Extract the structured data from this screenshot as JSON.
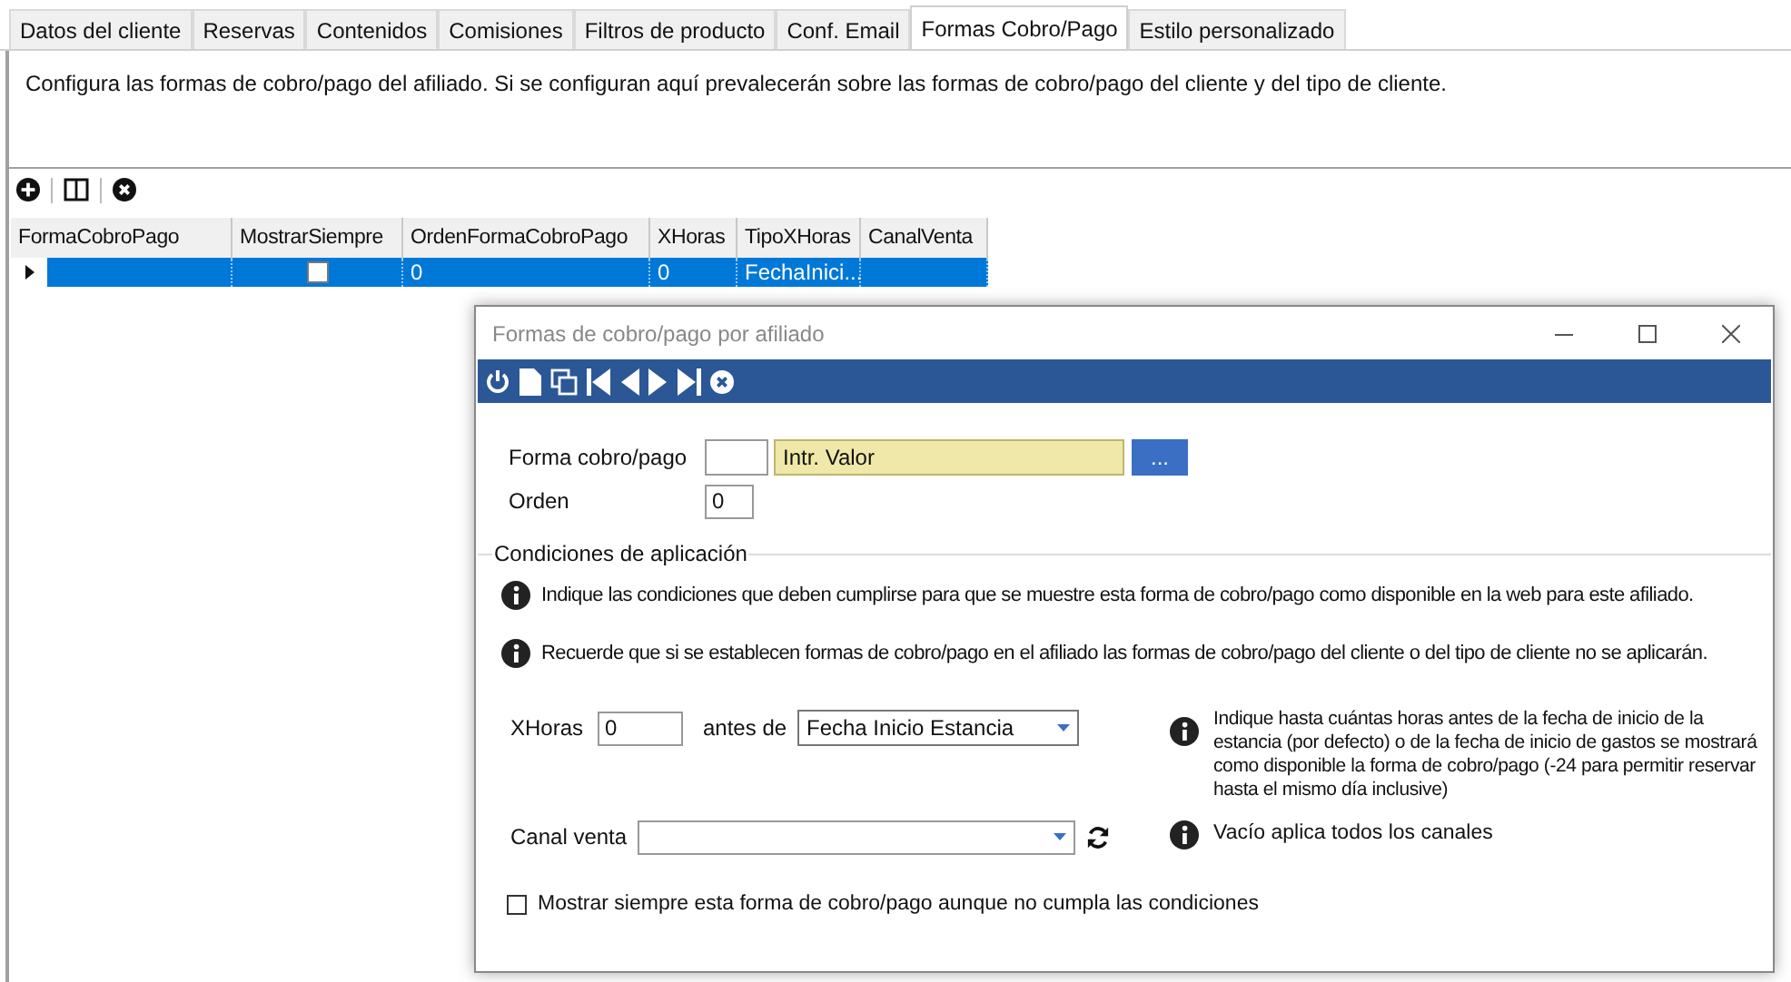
{
  "tabs": [
    {
      "label": "Datos del cliente",
      "selected": false
    },
    {
      "label": "Reservas",
      "selected": false
    },
    {
      "label": "Contenidos",
      "selected": false
    },
    {
      "label": "Comisiones",
      "selected": false
    },
    {
      "label": "Filtros de producto",
      "selected": false
    },
    {
      "label": "Conf. Email",
      "selected": false
    },
    {
      "label": "Formas Cobro/Pago",
      "selected": true
    },
    {
      "label": "Estilo personalizado",
      "selected": false
    }
  ],
  "description": "Configura las formas de cobro/pago del afiliado. Si se configuran aquí prevalecerán sobre las formas de cobro/pago del cliente y del tipo de cliente.",
  "grid": {
    "columns": [
      "FormaCobroPago",
      "MostrarSiempre",
      "OrdenFormaCobroPago",
      "XHoras",
      "TipoXHoras",
      "CanalVenta"
    ],
    "rows": [
      {
        "selected": true,
        "mostrar_siempre": false,
        "cells": [
          null,
          null,
          "0",
          "0",
          "FechaInici...",
          null
        ]
      }
    ]
  },
  "dialog": {
    "title": "Formas de cobro/pago por afiliado",
    "forma_label": "Forma cobro/pago",
    "forma_name": "Intr. Valor",
    "browse_button": "...",
    "orden_label": "Orden",
    "orden_value": "0",
    "section_title": "Condiciones de aplicación",
    "info_1": "Indique las condiciones que deben cumplirse para que se muestre esta forma de cobro/pago como disponible en la web para este afiliado.",
    "info_2": "Recuerde que si se establecen formas de cobro/pago en el afiliado las formas de cobro/pago del cliente o del tipo de cliente no se aplicarán.",
    "xhoras_label": "XHoras",
    "xhoras_value": "0",
    "antes_label": "antes de",
    "antes_value": "Fecha Inicio Estancia",
    "xhoras_info": "Indique hasta cuántas horas antes de la fecha de inicio de la estancia (por defecto) o de la fecha de inicio de gastos se mostrará como disponible la forma de cobro/pago (-24 para permitir reservar hasta el mismo día inclusive)",
    "canal_label": "Canal venta",
    "canal_info": "Vacío aplica todos los canales",
    "mostrar_label": "Mostrar siempre esta forma de cobro/pago aunque no cumpla las condiciones",
    "mostrar_checked": false
  }
}
